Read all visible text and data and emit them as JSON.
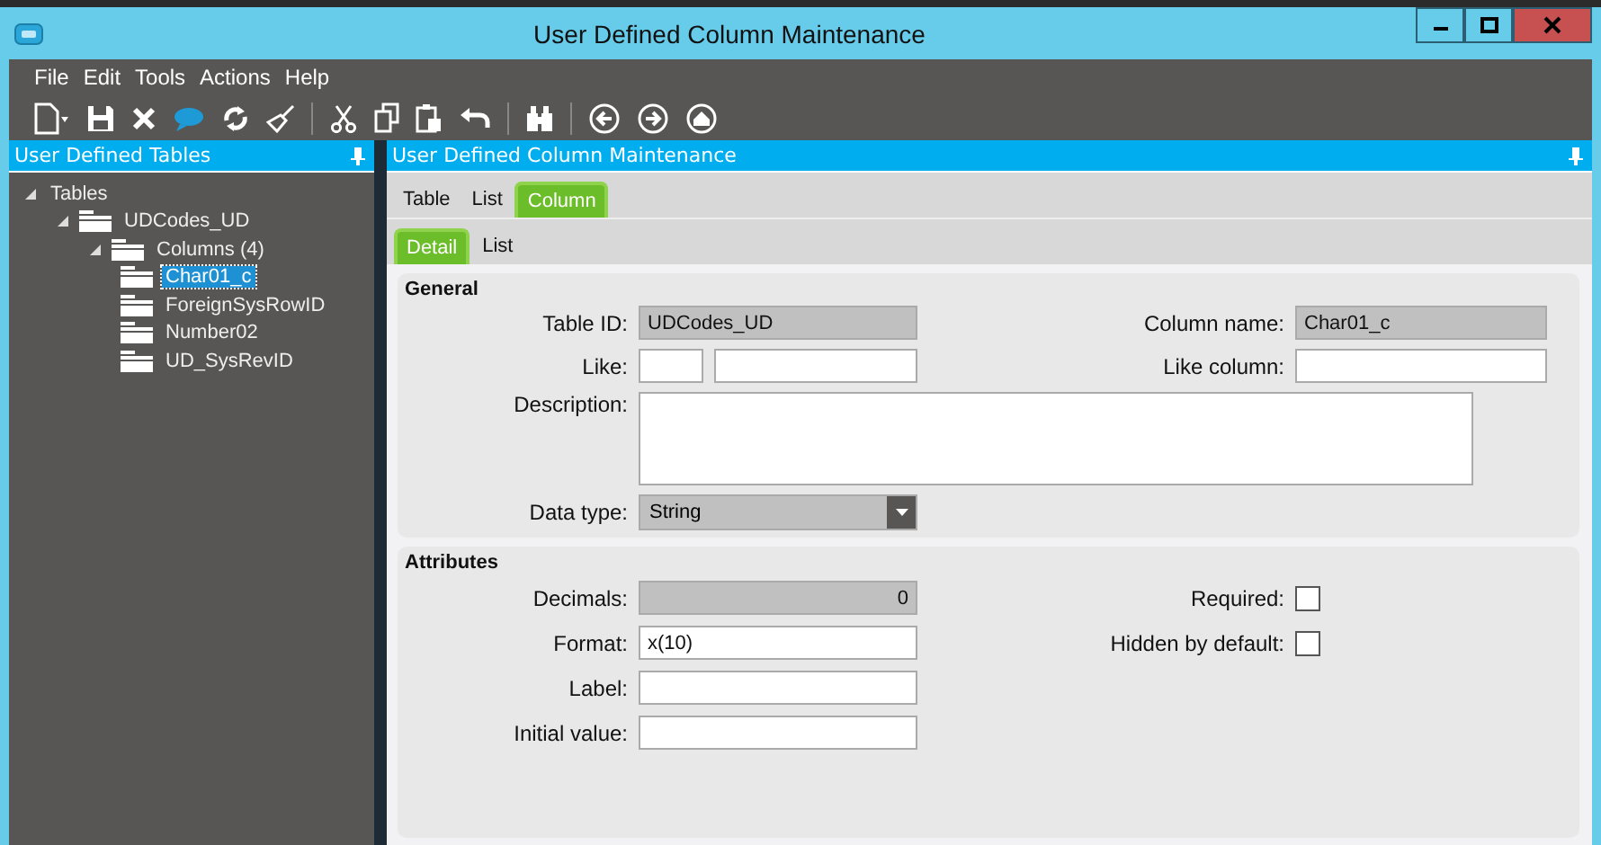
{
  "window": {
    "title": "User Defined Column Maintenance"
  },
  "menu": [
    "File",
    "Edit",
    "Tools",
    "Actions",
    "Help"
  ],
  "left_panel": {
    "title": "User Defined Tables",
    "tree": [
      {
        "label": "Tables",
        "expanded": true,
        "selected": false,
        "children": [
          {
            "label": "UDCodes_UD",
            "expanded": true,
            "selected": false,
            "children": [
              {
                "label": "Columns (4)",
                "expanded": true,
                "selected": false,
                "children": [
                  {
                    "label": "Char01_c",
                    "selected": true
                  },
                  {
                    "label": "ForeignSysRowID",
                    "selected": false
                  },
                  {
                    "label": "Number02",
                    "selected": false
                  },
                  {
                    "label": "UD_SysRevID",
                    "selected": false
                  }
                ]
              }
            ]
          }
        ]
      }
    ]
  },
  "right_panel": {
    "title": "User Defined Column Maintenance",
    "tabs": [
      {
        "label": "Table",
        "selected": false
      },
      {
        "label": "List",
        "selected": false
      },
      {
        "label": "Column",
        "selected": true
      }
    ],
    "subtabs": [
      {
        "label": "Detail",
        "selected": true
      },
      {
        "label": "List",
        "selected": false
      }
    ],
    "general": {
      "title": "General",
      "table_id": {
        "label": "Table ID:",
        "value": "UDCodes_UD",
        "disabled": true
      },
      "column_name": {
        "label": "Column name:",
        "value": "Char01_c",
        "disabled": true
      },
      "like": {
        "label": "Like:"
      },
      "like_column": {
        "label": "Like column:"
      },
      "description": {
        "label": "Description:"
      },
      "data_type": {
        "label": "Data type:",
        "value": "String"
      }
    },
    "attributes": {
      "title": "Attributes",
      "decimals": {
        "label": "Decimals:",
        "value": "0",
        "disabled": true
      },
      "format": {
        "label": "Format:",
        "value": "x(10)",
        "disabled": false
      },
      "label": {
        "label": "Label:"
      },
      "initial_value": {
        "label": "Initial value:"
      },
      "required": {
        "label": "Required:",
        "checked": false
      },
      "hidden_by_default": {
        "label": "Hidden by default:",
        "checked": false
      }
    }
  }
}
